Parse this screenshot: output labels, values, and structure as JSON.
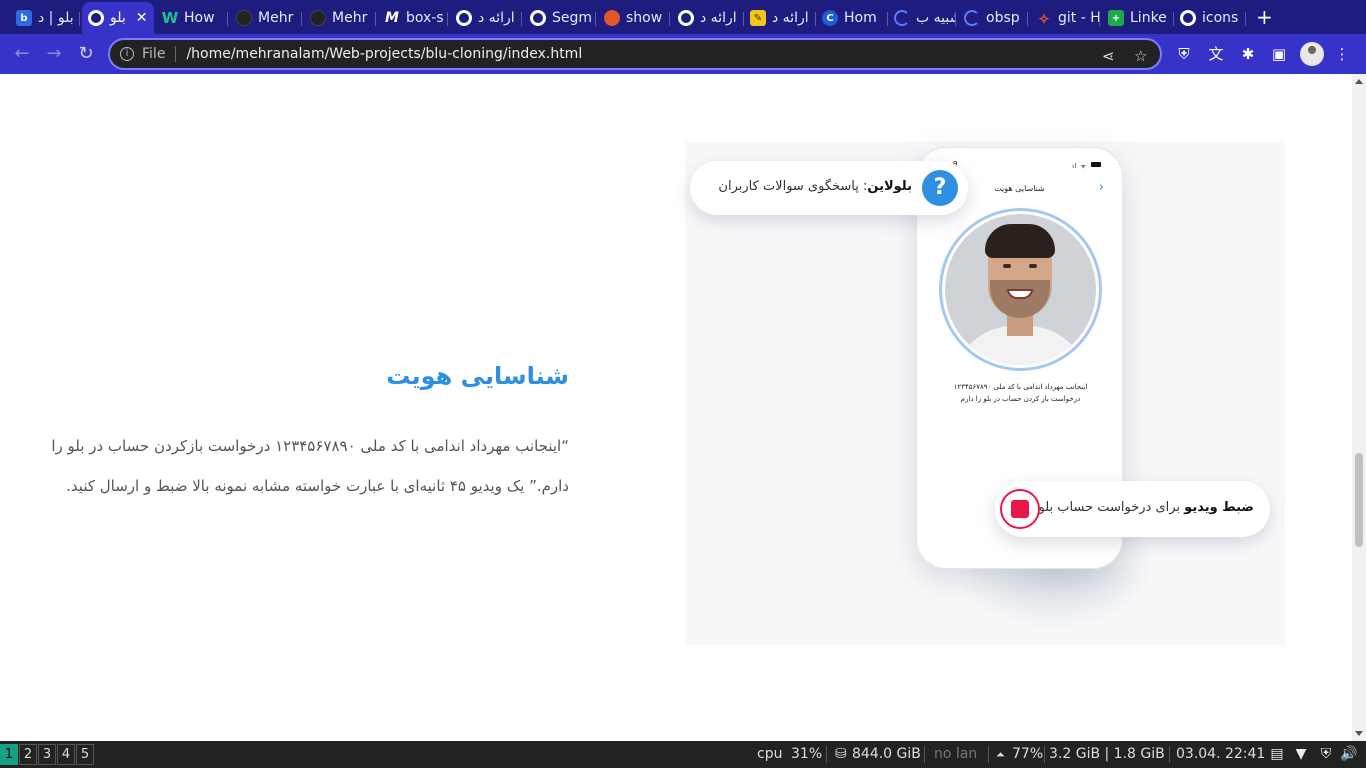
{
  "browser": {
    "tabs": [
      {
        "title": "بلو | د",
        "favicon": "blu-logo"
      },
      {
        "title": "بلو",
        "favicon": "globe-icon",
        "active": true
      },
      {
        "title": "How",
        "favicon": "w-logo"
      },
      {
        "title": "Mehr",
        "favicon": "github-icon"
      },
      {
        "title": "Mehr",
        "favicon": "github-icon"
      },
      {
        "title": "box-s",
        "favicon": "m-logo"
      },
      {
        "title": "ارائه د",
        "favicon": "globe-icon"
      },
      {
        "title": "Segm",
        "favicon": "globe-icon"
      },
      {
        "title": "show",
        "favicon": "orange-icon"
      },
      {
        "title": "ارائه د",
        "favicon": "globe-icon"
      },
      {
        "title": "ارائه د",
        "favicon": "note-icon"
      },
      {
        "title": "Hom",
        "favicon": "c-logo"
      },
      {
        "title": "شبیه ب",
        "favicon": "loading-icon"
      },
      {
        "title": "obsp",
        "favicon": "loading-icon"
      },
      {
        "title": "git - H",
        "favicon": "git-icon"
      },
      {
        "title": "Linke",
        "favicon": "green-icon"
      },
      {
        "title": "icons",
        "favicon": "globe-icon"
      }
    ],
    "address_bar": {
      "scheme_label": "File",
      "url": "/home/mehranalam/Web-projects/blu-cloning/index.html"
    }
  },
  "page": {
    "section_title": "شناسایی هویت",
    "section_body": "“اینجانب مهرداد اندامی با کد ملی ۱۲۳۴۵۶۷۸۹۰ درخواست بازکردن حساب در بلو را دارم.” یک ویدیو ۴۵ ثانیه‌ای با عبارت خواسته مشابه نمونه بالا ضبط و ارسال کنید.",
    "phone": {
      "header_title": "شناسایی هویت",
      "caption_line1": "اینجانب مهرداد اندامی با کد ملی ۱۲۳۴۵۶۷۸۹۰",
      "caption_line2": "درخواست باز کردن حساب در بلو را دارم"
    },
    "faq_badge": {
      "bold": "بلولاین",
      "text": ": پاسخگوی سوالات کاربران",
      "icon_glyph": "?"
    },
    "record_badge": {
      "bold": "ضبط ویدیو",
      "text": " برای درخواست حساب بلو"
    },
    "colors": {
      "accent": "#2f8fe0",
      "record": "#e8194a",
      "body_text": "#555555"
    }
  },
  "taskbar": {
    "workspaces": [
      "1",
      "2",
      "3",
      "4",
      "5"
    ],
    "active_workspace": "1",
    "cpu_label": "cpu",
    "cpu_value": "31%",
    "disk": "844.0 GiB",
    "network": "no lan",
    "battery": "77%",
    "memory": "3.2 GiB | 1.8 GiB",
    "datetime": "03.04. 22:41"
  }
}
